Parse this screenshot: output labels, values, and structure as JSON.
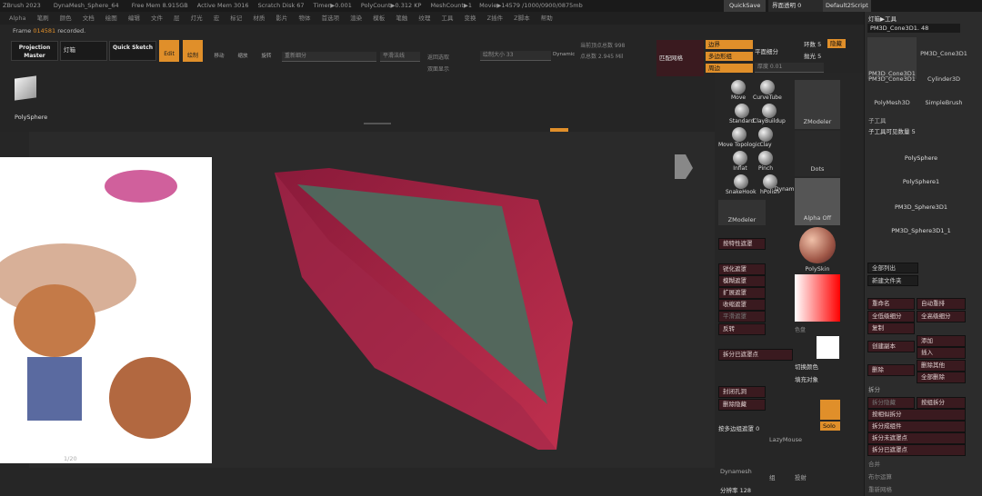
{
  "app": {
    "title_items": [
      "ZBrush 2023",
      "DynaMesh_Sphere_64",
      "Free Mem 8.915GB",
      "Active Mem 3016",
      "Scratch Disk 67",
      "Timer▶0.001",
      "PolyCount▶0.312 KP",
      "MeshCount▶1",
      "Movie▶14579 /1000/0900/0875mb"
    ],
    "quicksave": "QuickSave",
    "transparency": "界面透明 0",
    "script": "Default2Script"
  },
  "menu": [
    "Alpha",
    "笔刷",
    "颜色",
    "文档",
    "绘图",
    "编辑",
    "文件",
    "层",
    "灯光",
    "宏",
    "标记",
    "材质",
    "影片",
    "物体",
    "首选项",
    "渲染",
    "模板",
    "笔触",
    "纹理",
    "工具",
    "变换",
    "Z插件",
    "Z脚本",
    "帮助"
  ],
  "toolbar": {
    "frame_label": "Frame",
    "frame_value": "014581",
    "frame_suffix": "recorded.",
    "projection_master": "Projection Master",
    "lightbox": "灯箱",
    "quick_sketch": "Quick Sketch",
    "edit": "Edit",
    "draw": "绘制",
    "move": "移动",
    "scale": "缩放",
    "rotate": "旋转",
    "subdiv": "重新细分",
    "smooth_normals": "平滑法线",
    "target_polys": "当前顶点总数 998",
    "total_points": "点总数 2.945 Mil",
    "draw_size": "绘制大小 33",
    "dynamic": "Dynamic",
    "match_mesh": "匹配网格",
    "polygroup": "多边形组",
    "border": "边界",
    "perimeter": "周边",
    "flat_subdiv": "平面细分",
    "loops": "环数 5",
    "polish": "抛光 5",
    "thickness": "厚度 0.01",
    "hide": "隐藏",
    "sub_a": "返回选取",
    "sub_b": "双面显示"
  },
  "polysphere_label": "PolySphere",
  "brushes": [
    {
      "name": "Move"
    },
    {
      "name": "CurveTube"
    },
    {
      "name": "Standard"
    },
    {
      "name": "ClayBuildup"
    },
    {
      "name": "Move Topologic"
    },
    {
      "name": "Clay"
    },
    {
      "name": "Inflat"
    },
    {
      "name": "Pinch"
    },
    {
      "name": "SnakeHook"
    },
    {
      "name": "hPolish"
    }
  ],
  "brush_extra": "Dynamic",
  "zmodeler": "ZModeler",
  "zmodeler2": "ZModeler",
  "dots": "Dots",
  "alpha_off": "Alpha Off",
  "material": "PolySkin",
  "mid_menu": [
    "按特性遮罩",
    "锐化遮罩",
    "模糊遮罩",
    "扩展遮罩",
    "收缩遮罩",
    "平滑遮罩",
    "反转"
  ],
  "color_label": "色盘",
  "mid_menu2": [
    "拆分已遮罩点"
  ],
  "switch_color": "切换颜色",
  "fill_object": "填充对象",
  "close_holes": "封闭孔洞",
  "delete_hidden": "删除隐藏",
  "group_label": "按多边组遮罩 0",
  "lazymouse": "LazyMouse",
  "dynamesh": "Dynamesh",
  "resolution": "分辨率 128",
  "group": "组",
  "proj": "投射",
  "solo": "Solo",
  "page_counter": "1/20",
  "right": {
    "lightbox_tool": "灯箱▶工具",
    "current_tool": "PM3D_Cone3D1. 48",
    "tools": [
      {
        "name": "PM3D_Cone3D1"
      },
      {
        "name": "PM3D_Cone3D1"
      },
      {
        "name": "PM3D_Cone3D1"
      },
      {
        "name": "Cylinder3D"
      },
      {
        "name": "PolyMesh3D"
      },
      {
        "name": "SimpleBrush"
      }
    ],
    "subtool_header": "子工具",
    "visible_count": "子工具可见数量 5",
    "subtools": [
      "PolySphere",
      "PolySphere1",
      "PM3D_Sphere3D1",
      "PM3D_Sphere3D1_1"
    ],
    "list_all": "全部列出",
    "new_folder": "新建文件夹",
    "rename": "重命名",
    "auto_rename": "自动重排",
    "all_low": "全低级细分",
    "all_high": "全高级细分",
    "copy": "复制",
    "create_inst": "创建副本",
    "add": "添加",
    "insert": "插入",
    "delete": "删除",
    "del_other": "删除其他",
    "del_all": "全部删除",
    "split": "拆分",
    "split_hidden": "拆分隐藏",
    "split_group": "按组拆分",
    "split_similar": "按相似拆分",
    "split_parts": "拆分成组件",
    "split_unmasked": "拆分未遮罩点",
    "split_masked": "拆分已遮罩点",
    "merge": "合并",
    "boolean": "布尔运算",
    "remesh": "重新网格"
  }
}
